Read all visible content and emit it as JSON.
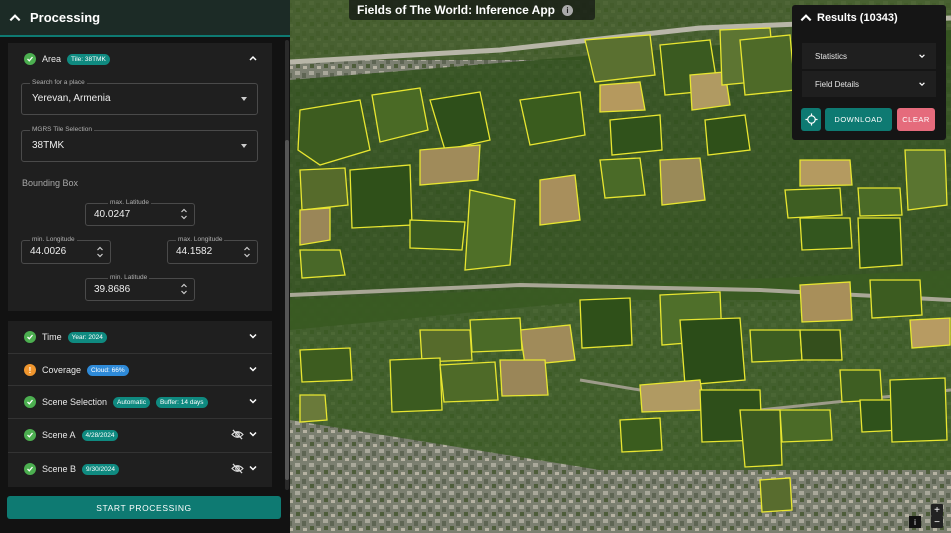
{
  "app": {
    "title": "Fields of The World: Inference App",
    "info_icon": "i"
  },
  "processing": {
    "header": "Processing",
    "area": {
      "title": "Area",
      "chip": "Tile: 38TMK",
      "place_label": "Search for a place",
      "place_value": "Yerevan, Armenia",
      "mgrs_label": "MGRS Tile Selection",
      "mgrs_value": "38TMK",
      "bbox_label": "Bounding Box",
      "max_lat_label": "max. Latitude",
      "max_lat": "40.0247",
      "min_lon_label": "min. Longitude",
      "min_lon": "44.0026",
      "max_lon_label": "max. Longitude",
      "max_lon": "44.1582",
      "min_lat_label": "min. Latitude",
      "min_lat": "39.8686"
    },
    "time": {
      "title": "Time",
      "chip": "Year: 2024"
    },
    "coverage": {
      "title": "Coverage",
      "chip": "Cloud: 66%"
    },
    "scene_selection": {
      "title": "Scene Selection",
      "chip1": "Automatic",
      "chip2": "Buffer: 14 days"
    },
    "scene_a": {
      "title": "Scene A",
      "chip": "4/28/2024"
    },
    "scene_b": {
      "title": "Scene B",
      "chip": "9/30/2024"
    },
    "start_button": "START PROCESSING"
  },
  "results": {
    "header": "Results (10343)",
    "statistics": "Statistics",
    "field_details": "Field Details",
    "download": "DOWNLOAD",
    "clear": "CLEAR"
  },
  "map": {
    "zoom_in": "+",
    "zoom_out": "−",
    "attribution_icon": "i",
    "colors": {
      "field_outline": "#e8e630",
      "vegetation": "#3c5a22",
      "urban": "#8a8a7a",
      "accent": "#0e7a72"
    }
  }
}
